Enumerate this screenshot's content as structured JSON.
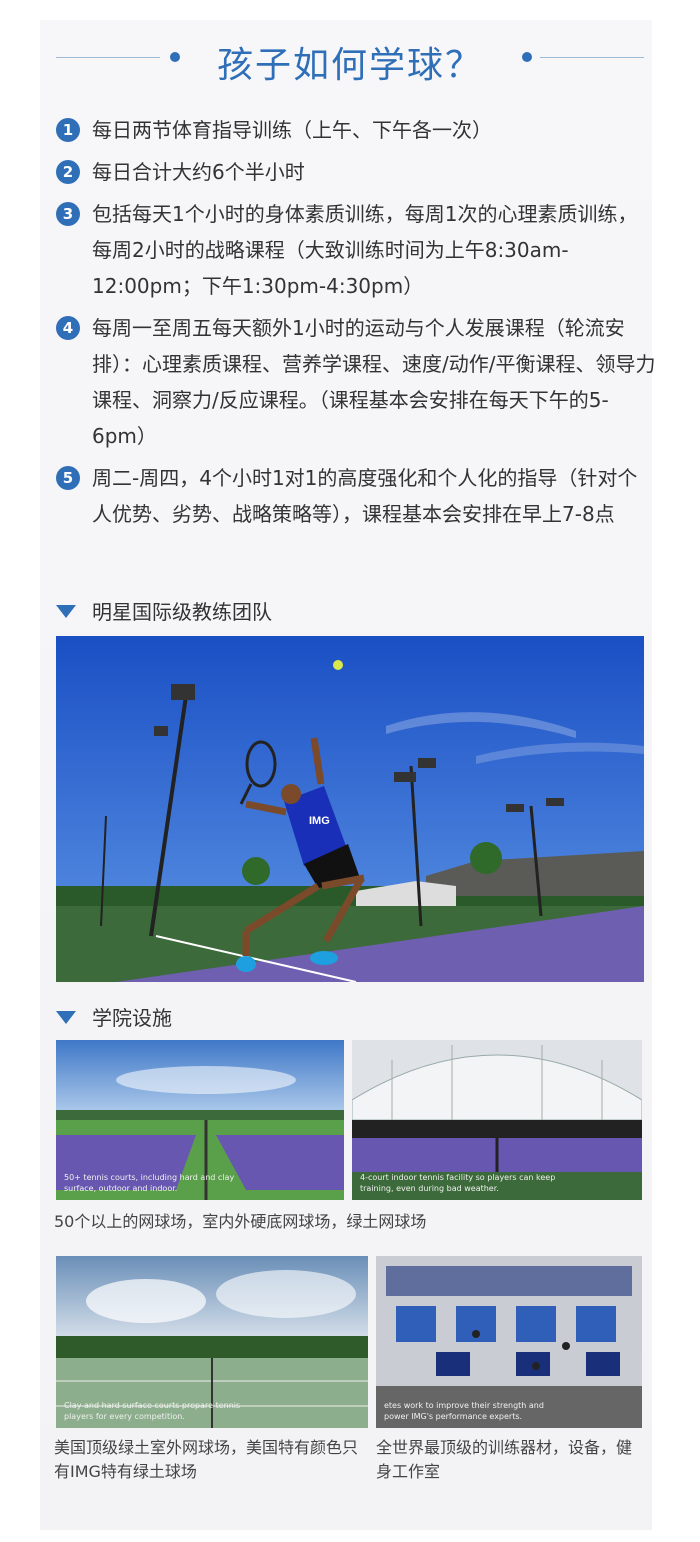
{
  "title": "孩子如何学球？",
  "items": [
    {
      "num": "1",
      "text": "每日两节体育指导训练（上午、下午各一次）"
    },
    {
      "num": "2",
      "text": "每日合计大约6个半小时"
    },
    {
      "num": "3",
      "text": "包括每天1个小时的身体素质训练，每周1次的心理素质训练，每周2小时的战略课程（大致训练时间为上午8:30am-12:00pm；下午1:30pm-4:30pm）"
    },
    {
      "num": "4",
      "text": "每周一至周五每天额外1小时的运动与个人发展课程（轮流安排）：心理素质课程、营养学课程、速度/动作/平衡课程、领导力课程、洞察力/反应课程。（课程基本会安排在每天下午的5-6pm）"
    },
    {
      "num": "5",
      "text": "周二-周四，4个小时1对1的高度强化和个人化的指导（针对个人优势、劣势、战略策略等），课程基本会安排在早上7-8点"
    }
  ],
  "coach_section": "明星国际级教练团队",
  "facility_section": "学院设施",
  "photos": {
    "outdoor_courts_overlay": "50+ tennis courts, including hard and clay surface, outdoor and indoor.",
    "indoor_courts_overlay": "4-court indoor tennis facility so players can keep training, even during bad weather.",
    "clay_courts_overlay": "Clay and hard surface courts prepare tennis players for every competition.",
    "gym_overlay": "etes work to improve their strength and power IMG's performance experts."
  },
  "captions": {
    "row1": "50个以上的网球场，室内外硬底网球场，绿土网球场",
    "clay": "美国顶级绿土室外网球场，美国特有颜色只有IMG特有绿土球场",
    "gym": "全世界最顶级的训练器材，设备，健身工作室"
  },
  "shirt_logo": "IMG",
  "colors": {
    "accent": "#2f6fb8",
    "court": "#6f5fb0",
    "sky": "#1f5fd0"
  }
}
